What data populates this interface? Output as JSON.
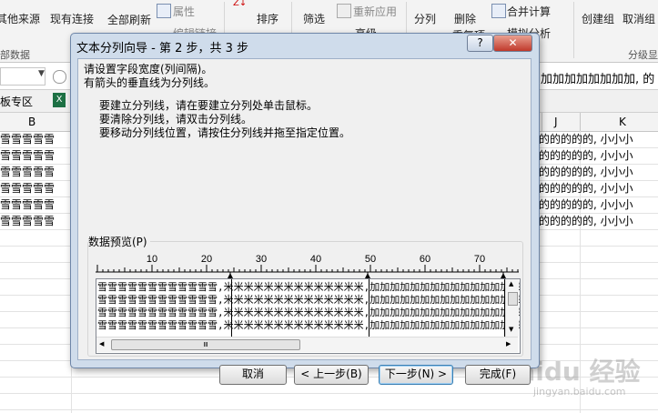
{
  "ribbon": {
    "left_items": [
      "其他来源",
      "现有连接",
      "全部刷新",
      "属性",
      "编辑链接"
    ],
    "group_left": "部数据",
    "sort_label": "排序",
    "filter_label": "筛选",
    "reapply_label": "重新应用",
    "advanced_label": "高级",
    "split_label": "分列",
    "delete_label": "删除",
    "dup_label": "重复项",
    "merge_label": "合并计算",
    "whatif_label": "模拟分析",
    "group_label": "创建组",
    "ungroup_label": "取消组",
    "outline_group": "分级显"
  },
  "formula_bar": {
    "content": "加加加加加加加加, 的"
  },
  "sheet_tabs": {
    "tab1": "板专区"
  },
  "columns": {
    "b": "B",
    "j": "J",
    "k": "K"
  },
  "sheet_rows": {
    "left": "雪雪雪雪雪",
    "right": "的的的的的, 小小小"
  },
  "dialog": {
    "title": "文本分列向导 - 第 2 步，共 3 步",
    "help_label": "?",
    "close_label": "✕",
    "line1": "请设置字段宽度(列间隔)。",
    "line2": "有箭头的垂直线为分列线。",
    "inst1": "要建立分列线，请在要建立分列处单击鼠标。",
    "inst2": "要清除分列线，请双击分列线。",
    "inst3": "要移动分列线位置，请按住分列线并拖至指定位置。",
    "preview_label": "数据预览(P)",
    "ruler_labels": [
      "10",
      "20",
      "30",
      "40",
      "50",
      "60",
      "70"
    ],
    "preview_rows": [
      "雪雪雪雪雪雪雪雪雪雪雪雪,米米米米米米米米米米米米米米,加加加加加加加加加加加加加加,的",
      "雪雪雪雪雪雪雪雪雪雪雪雪,米米米米米米米米米米米米米米,加加加加加加加加加加加加加加,的",
      "雪雪雪雪雪雪雪雪雪雪雪雪,米米米米米米米米米米米米米米,加加加加加加加加加加加加加加,的",
      "雪雪雪雪雪雪雪雪雪雪雪雪,米米米米米米米米米米米米米米,加加加加加加加加加加加加加加,的"
    ],
    "scroll_thumb": "Ⅲ",
    "buttons": {
      "cancel": "取消",
      "back": "< 上一步(B)",
      "next": "下一步(N) >",
      "finish": "完成(F)"
    }
  },
  "watermark": {
    "brand": "Baidu 经验",
    "url": "jingyan.baidu.com"
  }
}
